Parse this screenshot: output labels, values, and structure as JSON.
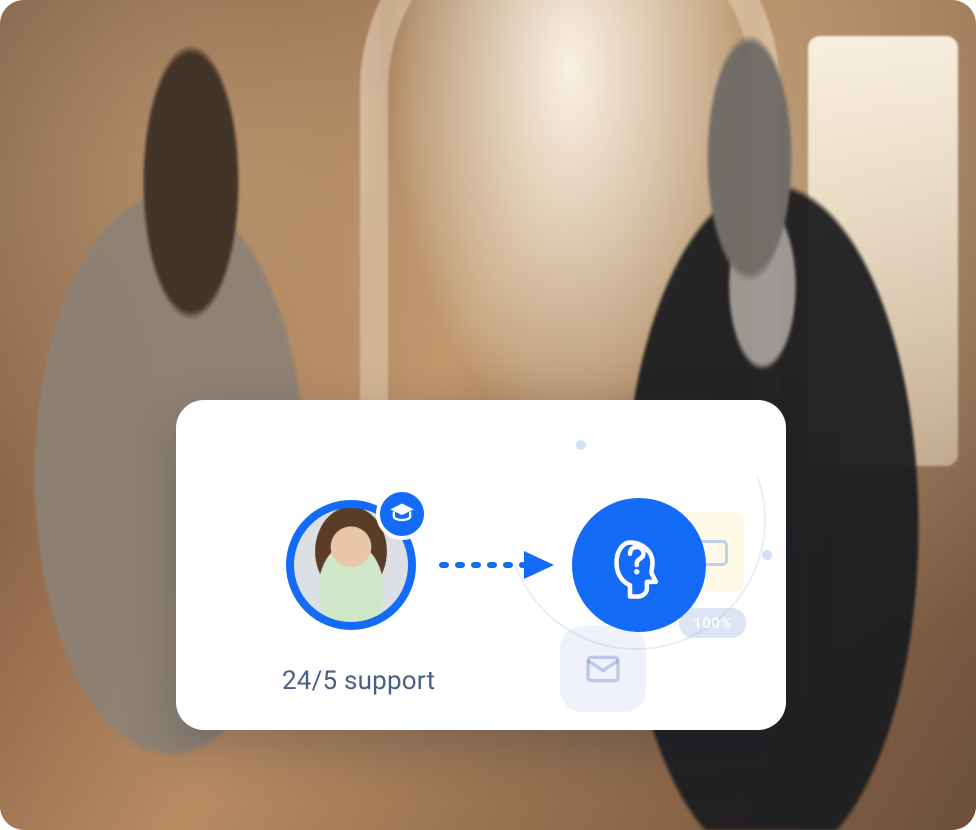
{
  "colors": {
    "accent": "#146bf7",
    "label": "#4a5f86"
  },
  "card": {
    "support_label": "24/5 support",
    "badge_text": "100%",
    "avatar_badge_icon": "graduation-cap-icon",
    "help_icon": "head-question-icon",
    "arrow_icon": "arrow-right-dashed-icon",
    "mail_icon": "mail-icon"
  }
}
